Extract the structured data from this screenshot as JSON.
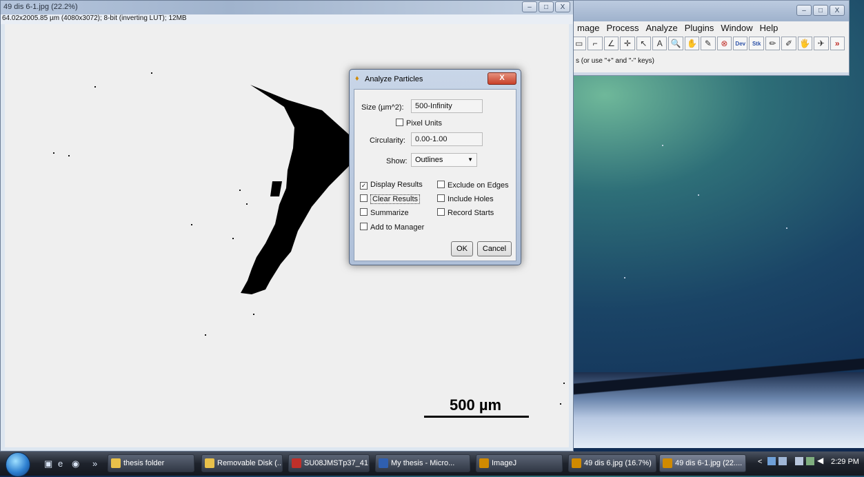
{
  "image_window": {
    "title": "49 dis 6-1.jpg (22.2%)",
    "info": "64.02x2005.85 µm (4080x3072); 8-bit (inverting LUT); 12MB",
    "scale_label": "500 µm",
    "buttons": [
      "–",
      "□",
      "X"
    ]
  },
  "imagej_window": {
    "menu": [
      "mage",
      "Process",
      "Analyze",
      "Plugins",
      "Window",
      "Help"
    ],
    "tools": [
      "▭",
      "⌐",
      "∠",
      "✛",
      "↖",
      "A",
      "🔍",
      "✋",
      "✎",
      "⊗",
      "Dev",
      "Stk",
      "✏",
      "✐",
      "🖐",
      "✈",
      "»"
    ],
    "status": "s (or use \"+\" and \"-\" keys)",
    "buttons": [
      "–",
      "□",
      "X"
    ]
  },
  "dialog": {
    "title": "Analyze Particles",
    "close": "X",
    "size_label": "Size (µm^2):",
    "size_value": "500-Infinity",
    "pixel_units": "Pixel Units",
    "circularity_label": "Circularity:",
    "circularity_value": "0.00-1.00",
    "show_label": "Show:",
    "show_value": "Outlines",
    "checkboxes": {
      "display_results": {
        "label": "Display Results",
        "checked": true
      },
      "exclude_edges": {
        "label": "Exclude on Edges",
        "checked": false
      },
      "clear_results": {
        "label": "Clear Results",
        "checked": false
      },
      "include_holes": {
        "label": "Include Holes",
        "checked": false
      },
      "summarize": {
        "label": "Summarize",
        "checked": false
      },
      "record_starts": {
        "label": "Record Starts",
        "checked": false
      },
      "add_to_manager": {
        "label": "Add to Manager",
        "checked": false
      }
    },
    "ok": "OK",
    "cancel": "Cancel",
    "check_mark": "✓"
  },
  "taskbar": {
    "chevron": "»",
    "tasks": [
      {
        "label": "thesis folder",
        "color": "#e8c04a"
      },
      {
        "label": "Removable Disk (...",
        "color": "#e8c04a"
      },
      {
        "label": "SU08JMSTp37_41...",
        "color": "#c0302a"
      },
      {
        "label": "My thesis - Micro...",
        "color": "#2f5fb0"
      },
      {
        "label": "ImageJ",
        "color": "#d08a00"
      },
      {
        "label": "49 dis 6.jpg (16.7%)",
        "color": "#d08a00"
      },
      {
        "label": "49 dis 6-1.jpg (22....",
        "color": "#d08a00"
      }
    ],
    "tray_arrow": "<",
    "clock": "2:29 PM"
  }
}
